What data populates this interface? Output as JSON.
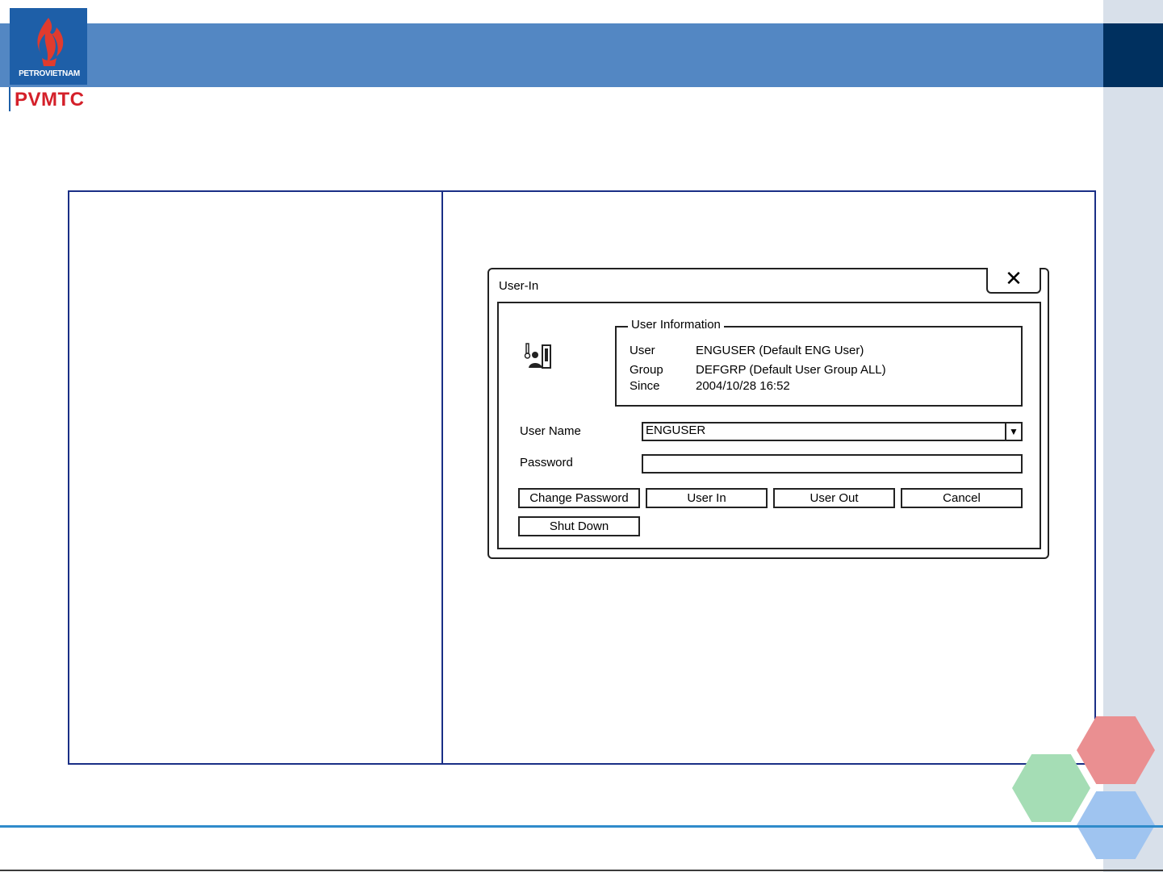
{
  "header": {
    "logo_text": "PETROVIETNAM",
    "brand": "PVMTC"
  },
  "dialog": {
    "title": "User-In",
    "close_label": "✕",
    "user_information": {
      "legend": "User Information",
      "rows": [
        {
          "label": "User",
          "value": "ENGUSER (Default ENG User)"
        },
        {
          "label": "Group",
          "value": "DEFGRP (Default User Group ALL)"
        },
        {
          "label": "Since",
          "value": "2004/10/28 16:52"
        }
      ]
    },
    "fields": {
      "user_name_label": "User Name",
      "user_name_value": "ENGUSER",
      "password_label": "Password",
      "password_value": ""
    },
    "buttons": {
      "change_password": "Change Password",
      "user_in": "User In",
      "user_out": "User Out",
      "cancel": "Cancel",
      "shut_down": "Shut Down"
    }
  },
  "colors": {
    "header_band": "#5387c3",
    "header_dark": "#00305f",
    "frame": "#1a2f86",
    "brand_red": "#d4202a",
    "hex_red": "#ea8f91",
    "hex_green": "#a5ddb5",
    "hex_blue": "#9fc4f0"
  }
}
